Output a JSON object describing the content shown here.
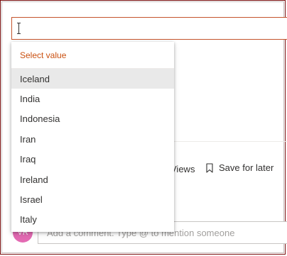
{
  "search": {
    "value": "",
    "focused": true
  },
  "dropdown": {
    "header": "Select value",
    "highlighted_index": 0,
    "options": [
      {
        "label": "Iceland"
      },
      {
        "label": "India"
      },
      {
        "label": "Indonesia"
      },
      {
        "label": "Iran"
      },
      {
        "label": "Iraq"
      },
      {
        "label": "Ireland"
      },
      {
        "label": "Israel"
      },
      {
        "label": "Italy"
      }
    ]
  },
  "actions": {
    "views_label": "Views",
    "save_label": "Save for later",
    "bookmark_icon": "bookmark-icon"
  },
  "comment": {
    "avatar_initials": "VR",
    "placeholder": "Add a comment. Type @ to mention someone"
  },
  "colors": {
    "accent": "#ca5010",
    "avatar": "#e36ab3",
    "highlight": "#e9e9e9"
  }
}
